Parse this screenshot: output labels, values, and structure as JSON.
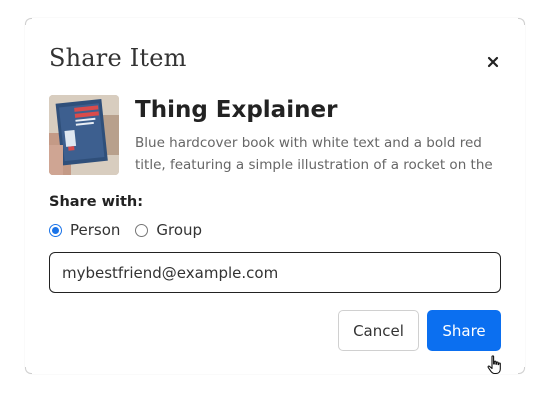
{
  "modal": {
    "title": "Share Item",
    "close_icon": "close-icon"
  },
  "item": {
    "title": "Thing Explainer",
    "description": "Blue hardcover book with white text and a bold red title, featuring a simple illustration of a rocket on the cover....",
    "thumbnail_icon": "book-cover-image",
    "thumbnail_text": "THING EXPLAINER"
  },
  "share": {
    "label": "Share with:",
    "options": [
      {
        "label": "Person",
        "selected": true
      },
      {
        "label": "Group",
        "selected": false
      }
    ],
    "email_value": "mybestfriend@example.com"
  },
  "actions": {
    "cancel_label": "Cancel",
    "share_label": "Share"
  },
  "colors": {
    "primary": "#0b6ff0",
    "radio_accent": "#1a73e8",
    "title_text": "#333333",
    "description_text": "#666666"
  },
  "cursor_icon": "hand-pointer-cursor-icon"
}
